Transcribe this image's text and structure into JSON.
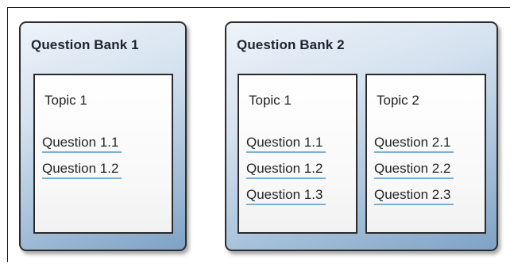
{
  "banks": [
    {
      "title": "Question Bank 1",
      "topics": [
        {
          "title": "Topic 1",
          "questions": [
            "Question 1.1",
            "Question 1.2"
          ]
        }
      ]
    },
    {
      "title": "Question Bank 2",
      "topics": [
        {
          "title": "Topic 1",
          "questions": [
            "Question 1.1",
            "Question 1.2",
            "Question 1.3"
          ]
        },
        {
          "title": "Topic 2",
          "questions": [
            "Question 2.1",
            "Question 2.2",
            "Question 2.3"
          ]
        }
      ]
    }
  ],
  "colors": {
    "bank_gradient_light": "#eef3f9",
    "bank_gradient_dark": "#7ea2c4",
    "question_underline": "#7ab0d6",
    "border": "#2d2d2d"
  }
}
